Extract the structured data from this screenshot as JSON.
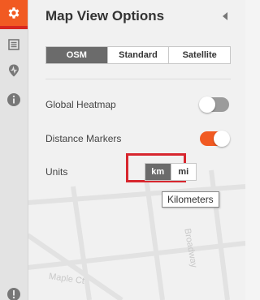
{
  "panel": {
    "title": "Map View Options"
  },
  "rail": {
    "items": [
      {
        "icon": "gear-icon",
        "active": true
      },
      {
        "icon": "list-icon",
        "active": false
      },
      {
        "icon": "route-icon",
        "active": false
      },
      {
        "icon": "info-icon",
        "active": false
      },
      {
        "icon": "alert-icon",
        "active": false
      }
    ]
  },
  "map_type": {
    "options": [
      "OSM",
      "Standard",
      "Satellite"
    ],
    "selected": "OSM"
  },
  "settings": {
    "global_heatmap": {
      "label": "Global Heatmap",
      "enabled": false
    },
    "distance_markers": {
      "label": "Distance Markers",
      "enabled": true
    },
    "units": {
      "label": "Units",
      "options": [
        "km",
        "mi"
      ],
      "selected": "km"
    }
  },
  "tooltip": {
    "text": "Kilometers"
  },
  "map_labels": [
    "Broadway",
    "Maple Ct"
  ],
  "colors": {
    "accent": "#f15a22",
    "highlight": "#d7262e",
    "selected_segment": "#6b6b6b"
  }
}
